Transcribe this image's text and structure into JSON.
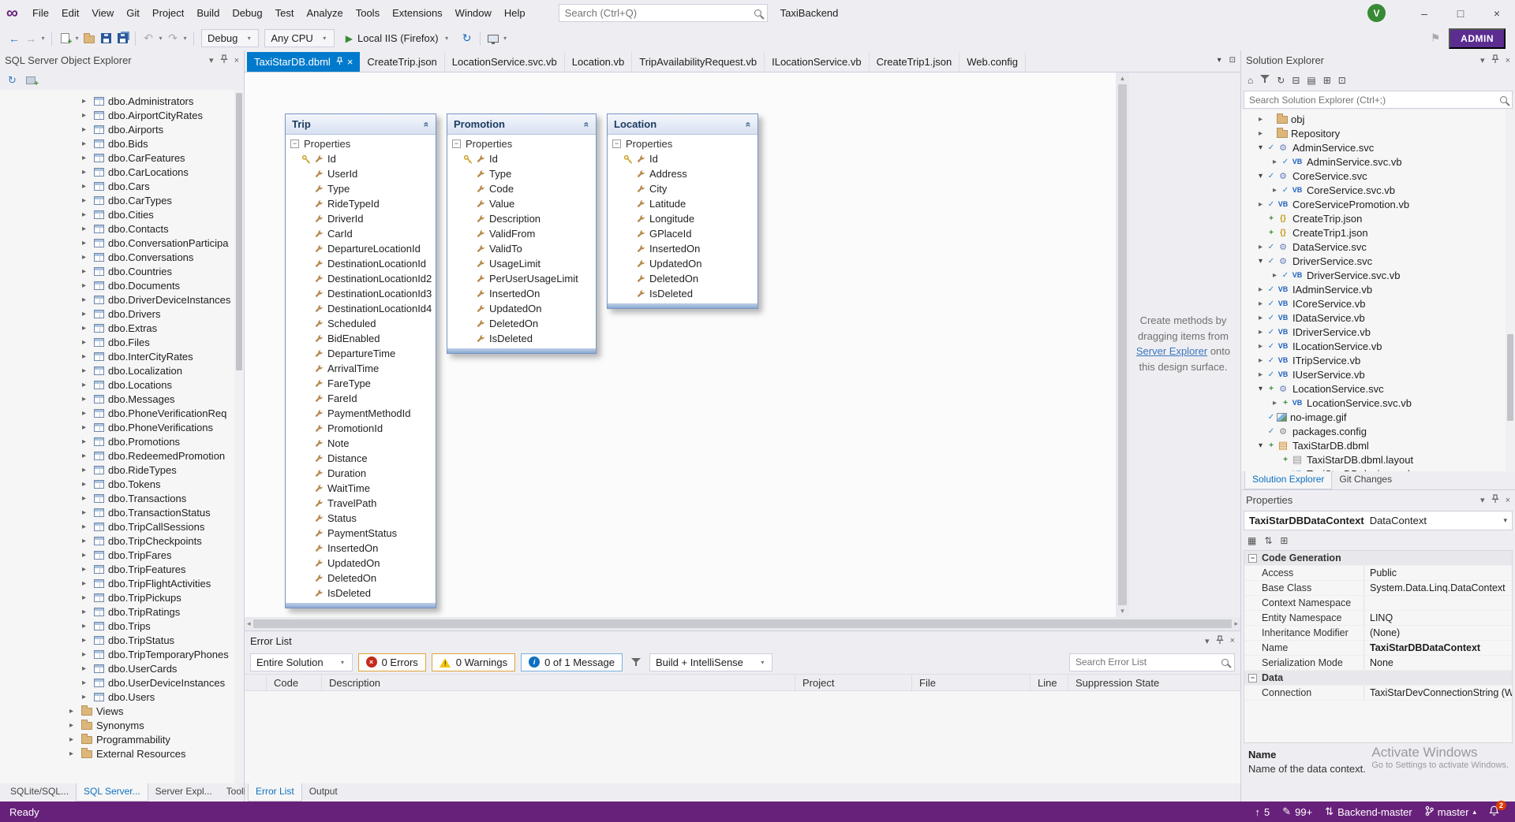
{
  "colors": {
    "accent": "#007acc",
    "statusbar": "#68217a",
    "admin_button": "#5c2d91",
    "avatar": "#388a34",
    "active_tab": "#007acc"
  },
  "titlebar": {
    "search_placeholder": "Search (Ctrl+Q)",
    "solution_badge": "TaxiBackend",
    "avatar_initial": "V",
    "minimize": "–",
    "maximize": "□",
    "close": "×",
    "menus": [
      "File",
      "Edit",
      "View",
      "Git",
      "Project",
      "Build",
      "Debug",
      "Test",
      "Analyze",
      "Tools",
      "Extensions",
      "Window",
      "Help"
    ]
  },
  "toolbar": {
    "configuration": "Debug",
    "platform": "Any CPU",
    "run_target": "Local IIS (Firefox)",
    "admin_label": "ADMIN"
  },
  "doc_tabs": [
    {
      "label": "TaxiStarDB.dbml",
      "active": true
    },
    {
      "label": "CreateTrip.json"
    },
    {
      "label": "LocationService.svc.vb"
    },
    {
      "label": "Location.vb"
    },
    {
      "label": "TripAvailabilityRequest.vb"
    },
    {
      "label": "ILocationService.vb"
    },
    {
      "label": "CreateTrip1.json"
    },
    {
      "label": "Web.config"
    }
  ],
  "sql_explorer": {
    "title": "SQL Server Object Explorer",
    "tables": [
      "dbo.Administrators",
      "dbo.AirportCityRates",
      "dbo.Airports",
      "dbo.Bids",
      "dbo.CarFeatures",
      "dbo.CarLocations",
      "dbo.Cars",
      "dbo.CarTypes",
      "dbo.Cities",
      "dbo.Contacts",
      "dbo.ConversationParticipa",
      "dbo.Conversations",
      "dbo.Countries",
      "dbo.Documents",
      "dbo.DriverDeviceInstances",
      "dbo.Drivers",
      "dbo.Extras",
      "dbo.Files",
      "dbo.InterCityRates",
      "dbo.Localization",
      "dbo.Locations",
      "dbo.Messages",
      "dbo.PhoneVerificationReq",
      "dbo.PhoneVerifications",
      "dbo.Promotions",
      "dbo.RedeemedPromotion",
      "dbo.RideTypes",
      "dbo.Tokens",
      "dbo.Transactions",
      "dbo.TransactionStatus",
      "dbo.TripCallSessions",
      "dbo.TripCheckpoints",
      "dbo.TripFares",
      "dbo.TripFeatures",
      "dbo.TripFlightActivities",
      "dbo.TripPickups",
      "dbo.TripRatings",
      "dbo.Trips",
      "dbo.TripStatus",
      "dbo.TripTemporaryPhones",
      "dbo.UserCards",
      "dbo.UserDeviceInstances",
      "dbo.Users"
    ],
    "folders": [
      "Views",
      "Synonyms",
      "Programmability",
      "External Resources"
    ],
    "bottom_tabs": [
      {
        "label": "SQLite/SQL..."
      },
      {
        "label": "SQL Server...",
        "active": true
      },
      {
        "label": "Server Expl..."
      },
      {
        "label": "Toolbox"
      }
    ]
  },
  "designer": {
    "hint_pre": "Create methods by dragging items from",
    "hint_link": "Server Explorer",
    "hint_post": "onto this design surface.",
    "entities": [
      {
        "name": "Trip",
        "section": "Properties",
        "props": [
          {
            "name": "Id",
            "key": true
          },
          {
            "name": "UserId"
          },
          {
            "name": "Type"
          },
          {
            "name": "RideTypeId"
          },
          {
            "name": "DriverId"
          },
          {
            "name": "CarId"
          },
          {
            "name": "DepartureLocationId"
          },
          {
            "name": "DestinationLocationId"
          },
          {
            "name": "DestinationLocationId2"
          },
          {
            "name": "DestinationLocationId3"
          },
          {
            "name": "DestinationLocationId4"
          },
          {
            "name": "Scheduled"
          },
          {
            "name": "BidEnabled"
          },
          {
            "name": "DepartureTime"
          },
          {
            "name": "Arrival​Time"
          },
          {
            "name": "FareType"
          },
          {
            "name": "FareId"
          },
          {
            "name": "PaymentMethodId"
          },
          {
            "name": "PromotionId"
          },
          {
            "name": "Note"
          },
          {
            "name": "Distance"
          },
          {
            "name": "Duration"
          },
          {
            "name": "WaitTime"
          },
          {
            "name": "TravelPath"
          },
          {
            "name": "Status"
          },
          {
            "name": "PaymentStatus"
          },
          {
            "name": "InsertedOn"
          },
          {
            "name": "UpdatedOn"
          },
          {
            "name": "DeletedOn"
          },
          {
            "name": "IsDeleted"
          }
        ]
      },
      {
        "name": "Promotion",
        "section": "Properties",
        "props": [
          {
            "name": "Id",
            "key": true
          },
          {
            "name": "Type"
          },
          {
            "name": "Code"
          },
          {
            "name": "Value"
          },
          {
            "name": "Description"
          },
          {
            "name": "ValidFrom"
          },
          {
            "name": "ValidTo"
          },
          {
            "name": "UsageLimit"
          },
          {
            "name": "PerUserUsageLimit"
          },
          {
            "name": "InsertedOn"
          },
          {
            "name": "UpdatedOn"
          },
          {
            "name": "DeletedOn"
          },
          {
            "name": "IsDeleted"
          }
        ]
      },
      {
        "name": "Location",
        "section": "Properties",
        "props": [
          {
            "name": "Id",
            "key": true
          },
          {
            "name": "Address"
          },
          {
            "name": "City"
          },
          {
            "name": "Latitude"
          },
          {
            "name": "Longitude"
          },
          {
            "name": "GPlaceId"
          },
          {
            "name": "InsertedOn"
          },
          {
            "name": "UpdatedOn"
          },
          {
            "name": "DeletedOn"
          },
          {
            "name": "IsDeleted"
          }
        ]
      }
    ]
  },
  "solution_explorer": {
    "title": "Solution Explorer",
    "search_placeholder": "Search Solution Explorer (Ctrl+;)",
    "items": [
      {
        "label": "obj",
        "indent": "ind0",
        "expander": "col",
        "icon": "folder",
        "badge": "nobadge"
      },
      {
        "label": "Repository",
        "indent": "ind0",
        "expander": "col",
        "icon": "folder",
        "badge": "nobadge"
      },
      {
        "label": "AdminService.svc",
        "indent": "ind0",
        "expander": "exp",
        "icon": "svc",
        "badge": "check"
      },
      {
        "label": "AdminService.svc.vb",
        "indent": "ind1",
        "expander": "col",
        "icon": "vb",
        "badge": "check"
      },
      {
        "label": "CoreService.svc",
        "indent": "ind0",
        "expander": "exp",
        "icon": "svc",
        "badge": "check"
      },
      {
        "label": "CoreService.svc.vb",
        "indent": "ind1",
        "expander": "col",
        "icon": "vb",
        "badge": "check"
      },
      {
        "label": "CoreServicePromotion.vb",
        "indent": "ind0",
        "expander": "col",
        "icon": "vb",
        "badge": "check"
      },
      {
        "label": "CreateTrip.json",
        "indent": "ind0",
        "expander": "noexp",
        "icon": "json",
        "badge": "plus"
      },
      {
        "label": "CreateTrip1.json",
        "indent": "ind0",
        "expander": "noexp",
        "icon": "json",
        "badge": "plus"
      },
      {
        "label": "DataService.svc",
        "indent": "ind0",
        "expander": "col",
        "icon": "svc",
        "badge": "check"
      },
      {
        "label": "DriverService.svc",
        "indent": "ind0",
        "expander": "exp",
        "icon": "svc",
        "badge": "check"
      },
      {
        "label": "DriverService.svc.vb",
        "indent": "ind1",
        "expander": "col",
        "icon": "vb",
        "badge": "check"
      },
      {
        "label": "IAdminService.vb",
        "indent": "ind0",
        "expander": "col",
        "icon": "vb",
        "badge": "check"
      },
      {
        "label": "ICoreService.vb",
        "indent": "ind0",
        "expander": "col",
        "icon": "vb",
        "badge": "check"
      },
      {
        "label": "IDataService.vb",
        "indent": "ind0",
        "expander": "col",
        "icon": "vb",
        "badge": "check"
      },
      {
        "label": "IDriverService.vb",
        "indent": "ind0",
        "expander": "col",
        "icon": "vb",
        "badge": "check"
      },
      {
        "label": "ILocationService.vb",
        "indent": "ind0",
        "expander": "col",
        "icon": "vb",
        "badge": "check"
      },
      {
        "label": "ITripService.vb",
        "indent": "ind0",
        "expander": "col",
        "icon": "vb",
        "badge": "check"
      },
      {
        "label": "IUserService.vb",
        "indent": "ind0",
        "expander": "col",
        "icon": "vb",
        "badge": "check"
      },
      {
        "label": "LocationService.svc",
        "indent": "ind0",
        "expander": "exp",
        "icon": "svc",
        "badge": "plus"
      },
      {
        "label": "LocationService.svc.vb",
        "indent": "ind1",
        "expander": "col",
        "icon": "vb",
        "badge": "plus"
      },
      {
        "label": "no-image.gif",
        "indent": "ind0",
        "expander": "noexp",
        "icon": "img",
        "badge": "check"
      },
      {
        "label": "packages.config",
        "indent": "ind0",
        "expander": "noexp",
        "icon": "config",
        "badge": "check"
      },
      {
        "label": "TaxiStarDB.dbml",
        "indent": "ind0",
        "expander": "exp",
        "icon": "dbml",
        "badge": "plus"
      },
      {
        "label": "TaxiStarDB.dbml.layout",
        "indent": "ind1",
        "expander": "noexp",
        "icon": "layout",
        "badge": "plus"
      },
      {
        "label": "TaxiStarDB.designer.vb",
        "indent": "ind1",
        "expander": "col",
        "icon": "vb",
        "badge": "plus"
      }
    ],
    "bottom_tabs": [
      {
        "label": "Solution Explorer",
        "active": true
      },
      {
        "label": "Git Changes"
      }
    ]
  },
  "properties_panel": {
    "title": "Properties",
    "object_name": "TaxiStarDBDataContext",
    "object_type": "DataContext",
    "group1_name": "Code Generation",
    "group1_rows": [
      {
        "label": "Access",
        "value": "Public"
      },
      {
        "label": "Base Class",
        "value": "System.Data.Linq.DataContext"
      },
      {
        "label": "Context Namespace",
        "value": ""
      },
      {
        "label": "Entity Namespace",
        "value": "LINQ"
      },
      {
        "label": "Inheritance Modifier",
        "value": "(None)"
      },
      {
        "label": "Name",
        "value": "TaxiStarDBDataContext",
        "bold": true
      },
      {
        "label": "Serialization Mode",
        "value": "None"
      }
    ],
    "group2_name": "Data",
    "group2_rows": [
      {
        "label": "Connection",
        "value": "TaxiStarDevConnectionString (W"
      }
    ],
    "help_title": "Name",
    "help_text": "Name of the data context."
  },
  "watermark": {
    "line1": "Activate Windows",
    "line2": "Go to Settings to activate Windows."
  },
  "error_list": {
    "title": "Error List",
    "scope": "Entire Solution",
    "errors_label": "0 Errors",
    "warnings_label": "0 Warnings",
    "messages_label": "0 of 1 Message",
    "build_filter": "Build + IntelliSense",
    "search_placeholder": "Search Error List",
    "columns": [
      "Code",
      "Description",
      "Project",
      "File",
      "Line",
      "Suppression State"
    ],
    "bottom_tabs": [
      {
        "label": "Error List",
        "active": true
      },
      {
        "label": "Output"
      }
    ]
  },
  "status_bar": {
    "ready": "Ready",
    "outgoing_commits": "5",
    "pending_edits": "99+",
    "repo_name": "Backend-master",
    "branch_name": "master",
    "notification_count": "2"
  }
}
